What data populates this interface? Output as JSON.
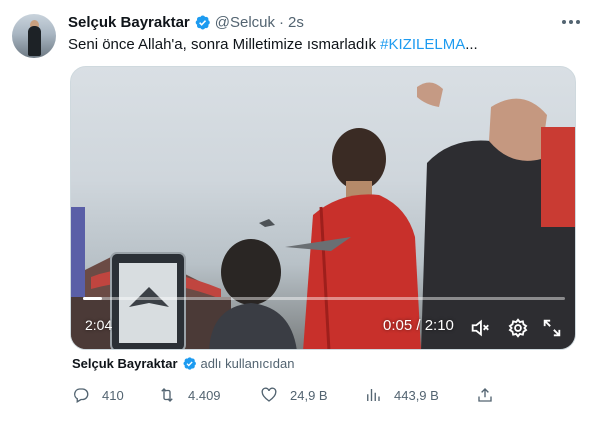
{
  "author": {
    "name": "Selçuk Bayraktar",
    "handle": "@Selcuk",
    "time": "2s",
    "separator": "·"
  },
  "tweet": {
    "text": "Seni önce Allah'a, sonra Milletimize ısmarladık ",
    "hashtag": "#KIZILELMA",
    "ellipsis": "..."
  },
  "video": {
    "duration_badge": "2:04",
    "time_readout": "0:05 / 2:10",
    "progress_fraction": 0.04,
    "icons": [
      "volume-mute-icon",
      "settings-icon",
      "fullscreen-icon"
    ]
  },
  "attribution": {
    "name": "Selçuk Bayraktar",
    "from": "adlı kullanıcıdan"
  },
  "actions": {
    "replies": "410",
    "retweets": "4.409",
    "likes": "24,9 B",
    "views": "443,9 B"
  },
  "colors": {
    "accent": "#1d9bf0",
    "secondary_text": "#536471",
    "primary_text": "#0f1419"
  }
}
